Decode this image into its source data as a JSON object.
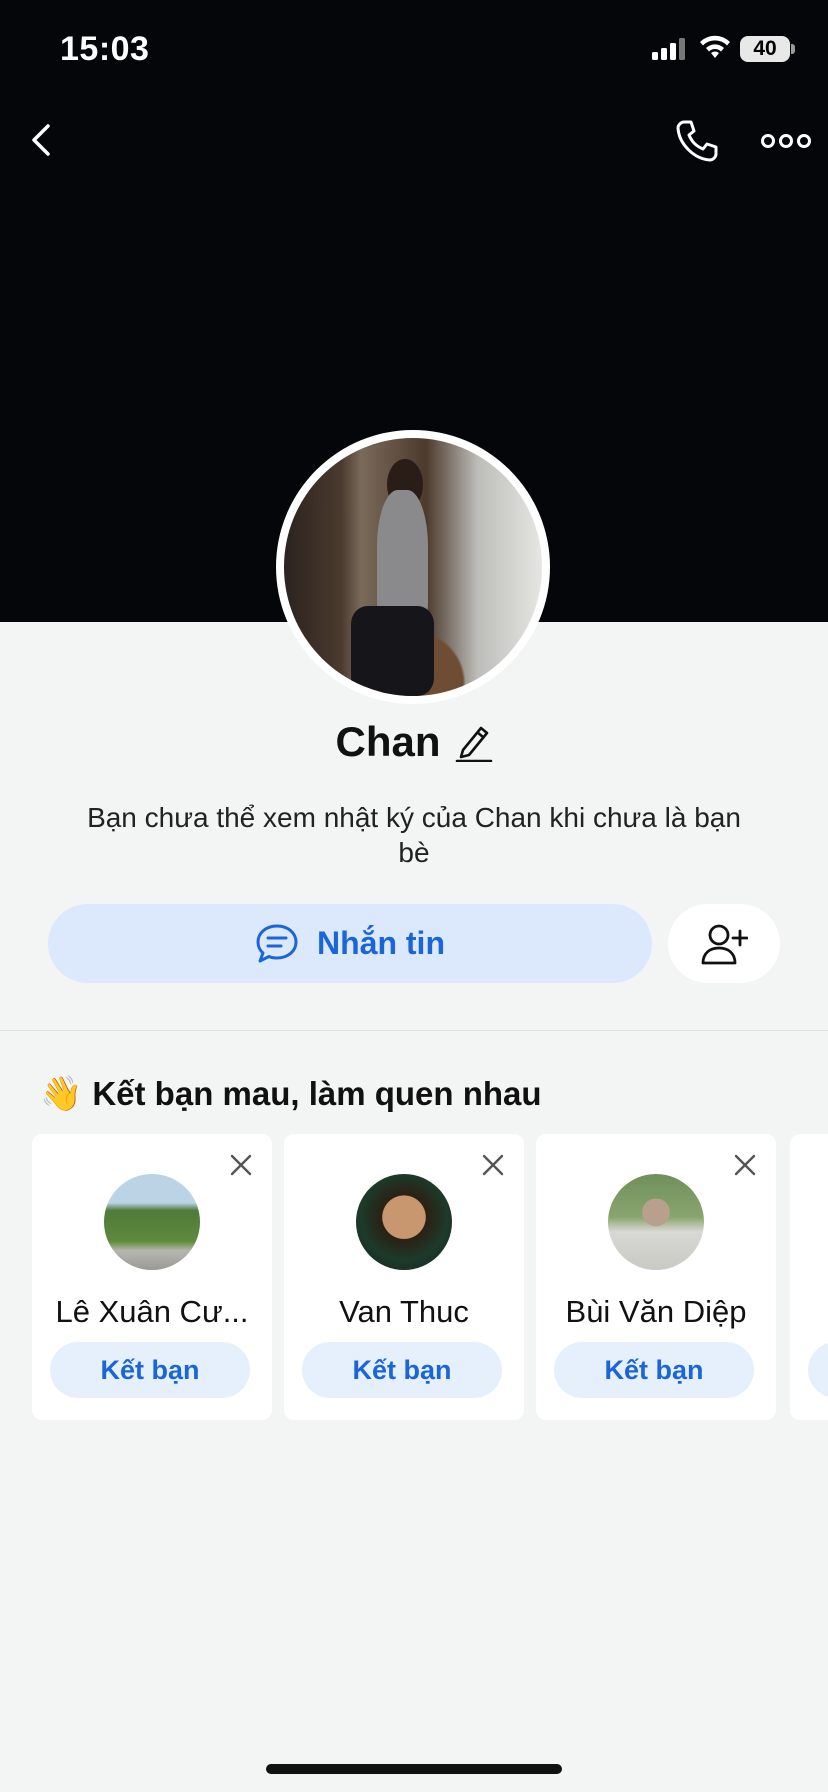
{
  "status_bar": {
    "time": "15:03",
    "battery": "40"
  },
  "profile": {
    "name": "Chan",
    "notice": "Bạn chưa thể xem nhật ký của Chan khi chưa là bạn bè"
  },
  "actions": {
    "message_label": "Nhắn tin"
  },
  "suggestions": {
    "title": "Kết bạn mau, làm quen nhau",
    "title_emoji": "👋",
    "items": [
      {
        "name": "Lê Xuân Cư...",
        "button": "Kết bạn"
      },
      {
        "name": "Van Thuc",
        "button": "Kết bạn"
      },
      {
        "name": "Bùi Văn Diệp",
        "button": "Kết bạn"
      }
    ]
  },
  "colors": {
    "accent": "#1a66d9",
    "accent_bg": "#dce9fc",
    "cover": "#04060a",
    "page_bg": "#f3f4f4"
  },
  "icons": [
    "back-icon",
    "phone-icon",
    "more-icon",
    "edit-icon",
    "chat-icon",
    "add-friend-icon",
    "close-icon"
  ]
}
